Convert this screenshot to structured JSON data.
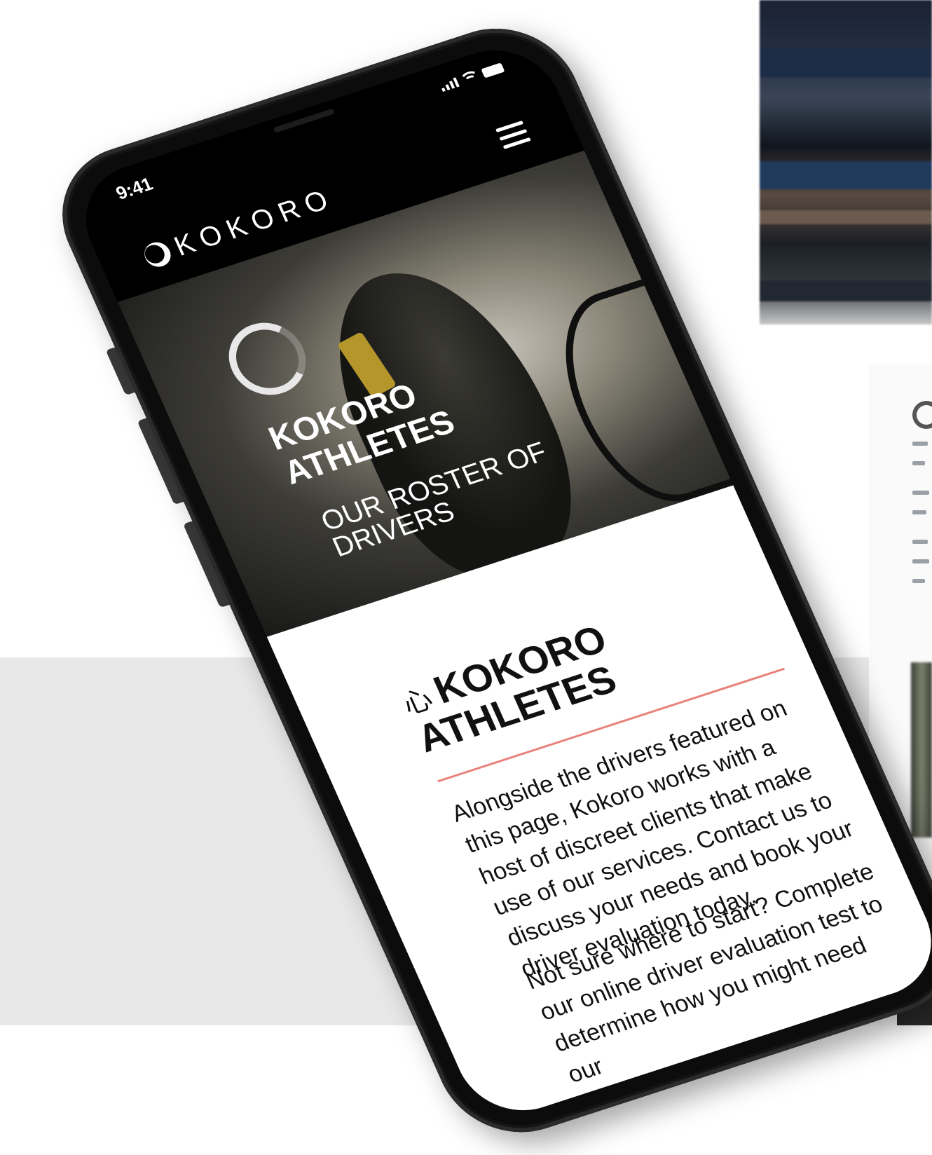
{
  "status_bar": {
    "time": "9:41"
  },
  "header": {
    "brand": "KOKORO",
    "menu_icon": "hamburger-icon"
  },
  "hero": {
    "title_line1": "KOKORO",
    "title_line2": "ATHLETES",
    "subtitle_line1": "OUR ROSTER OF",
    "subtitle_line2": "DRIVERS"
  },
  "section": {
    "kanji": "心",
    "title_line1": "KOKORO",
    "title_line2": "ATHLETES",
    "paragraph1": "Alongside the drivers featured on this page, Kokoro works with a host of discreet clients that make use of our services. Contact us to discuss your needs and book your driver evaluation today.",
    "paragraph2": "Not sure where to start? Complete our online driver evaluation test to determine how you might need our",
    "paragraph3": "tured on"
  },
  "colors": {
    "accent_rule": "#e9827a",
    "header_bg": "#000000",
    "band_bg": "#e8e8e8"
  }
}
